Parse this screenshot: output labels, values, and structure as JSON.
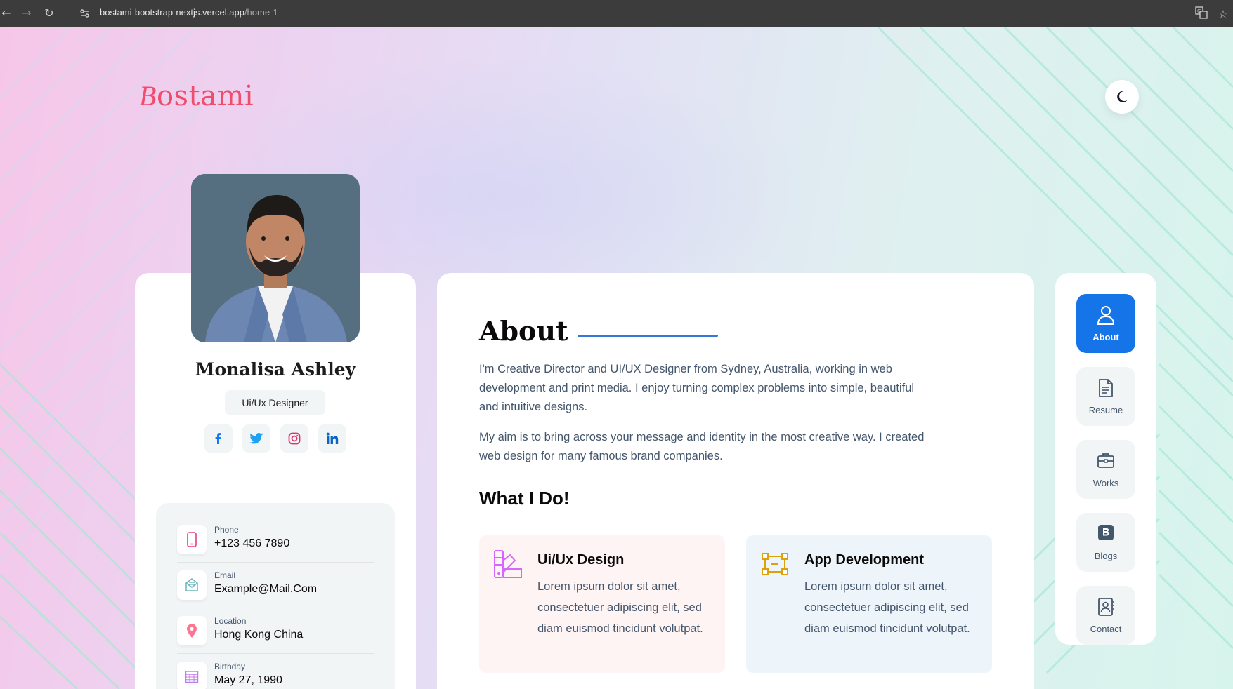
{
  "browser": {
    "url_host": "bostami-bootstrap-nextjs.vercel.app",
    "url_path": "/home-1"
  },
  "header": {
    "logo_first": "B",
    "logo_rest": "ostami"
  },
  "profile": {
    "name": "Monalisa Ashley",
    "role": "Ui/Ux Designer",
    "socials": [
      "facebook-icon",
      "twitter-icon",
      "instagram-icon",
      "linkedin-icon"
    ],
    "contacts": [
      {
        "label": "Phone",
        "value": "+123 456 7890",
        "icon": "phone-icon",
        "color": "#e93b81"
      },
      {
        "label": "Email",
        "value": "Example@Mail.Com",
        "icon": "email-icon",
        "color": "#6ab5b9"
      },
      {
        "label": "Location",
        "value": "Hong Kong China",
        "icon": "location-icon",
        "color": "#fd7590"
      },
      {
        "label": "Birthday",
        "value": "May 27, 1990",
        "icon": "calendar-icon",
        "color": "#c17ceb"
      }
    ]
  },
  "about": {
    "title": "About",
    "paragraph1": "I'm Creative Director and UI/UX Designer from Sydney, Australia, working in web development and print media. I enjoy turning complex problems into simple, beautiful and intuitive designs.",
    "paragraph2": "My aim is to bring across your message and identity in the most creative way. I created web design for many famous brand companies.",
    "what_i_do": "What I Do!",
    "services": [
      {
        "title": "Ui/Ux Design",
        "desc": "Lorem ipsum dolor sit amet, consectetuer adipiscing elit, sed diam euismod tincidunt volutpat.",
        "bg": "#fcf4ff",
        "icon": "design-icon"
      },
      {
        "title": "App Development",
        "desc": "Lorem ipsum dolor sit amet, consectetuer adipiscing elit, sed diam euismod tincidunt volutpat.",
        "bg": "#eef5fa",
        "icon": "app-dev-icon"
      }
    ]
  },
  "nav": {
    "items": [
      {
        "label": "About",
        "icon": "user-icon",
        "active": true
      },
      {
        "label": "Resume",
        "icon": "document-icon",
        "active": false
      },
      {
        "label": "Works",
        "icon": "briefcase-icon",
        "active": false
      },
      {
        "label": "Blogs",
        "icon": "blog-icon",
        "active": false
      },
      {
        "label": "Contact",
        "icon": "contact-book-icon",
        "active": false
      }
    ]
  },
  "colors": {
    "accent": "#1574e8",
    "logo": "#ef4d6d",
    "title_line": "#3676d8"
  }
}
